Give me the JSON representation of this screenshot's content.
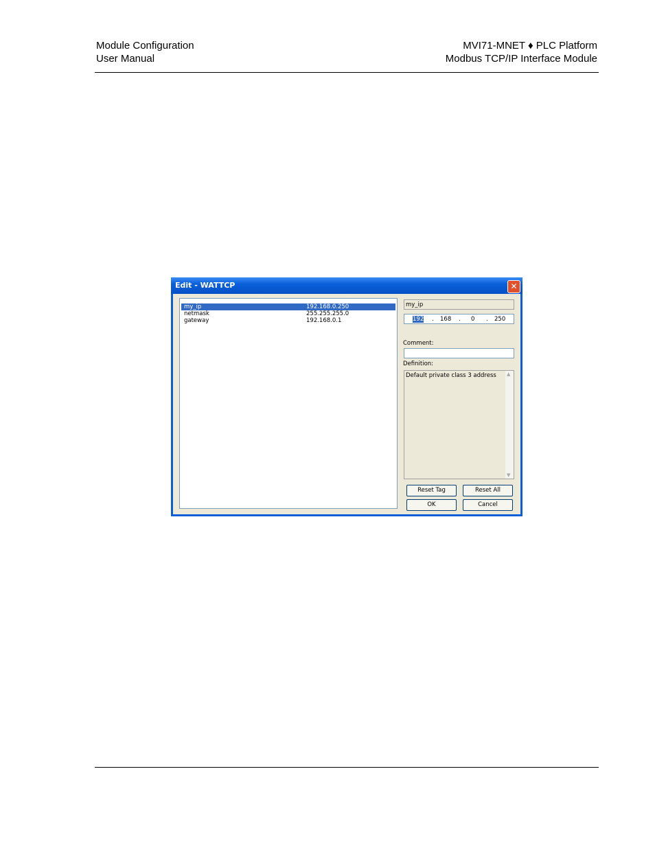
{
  "header": {
    "left_line1": "Module Configuration",
    "left_line2": "User Manual",
    "right_line1": "MVI71-MNET ♦ PLC Platform",
    "right_line2": "Modbus TCP/IP Interface Module"
  },
  "dialog": {
    "title": "Edit - WATTCP",
    "close_glyph": "✕",
    "rows": [
      {
        "name": "my_ip",
        "value": "192.168.0.250",
        "selected": true
      },
      {
        "name": "netmask",
        "value": "255.255.255.0",
        "selected": false
      },
      {
        "name": "gateway",
        "value": "192.168.0.1",
        "selected": false
      }
    ],
    "tag_name": "my_ip",
    "ip": {
      "o1": "192",
      "o2": "168",
      "o3": "0",
      "o4": "250",
      "dot": "."
    },
    "comment_label": "Comment:",
    "comment_value": "",
    "definition_label": "Definition:",
    "definition_text": "Default private class 3 address",
    "buttons": {
      "reset_tag": "Reset Tag",
      "reset_all": "Reset All",
      "ok": "OK",
      "cancel": "Cancel"
    }
  }
}
